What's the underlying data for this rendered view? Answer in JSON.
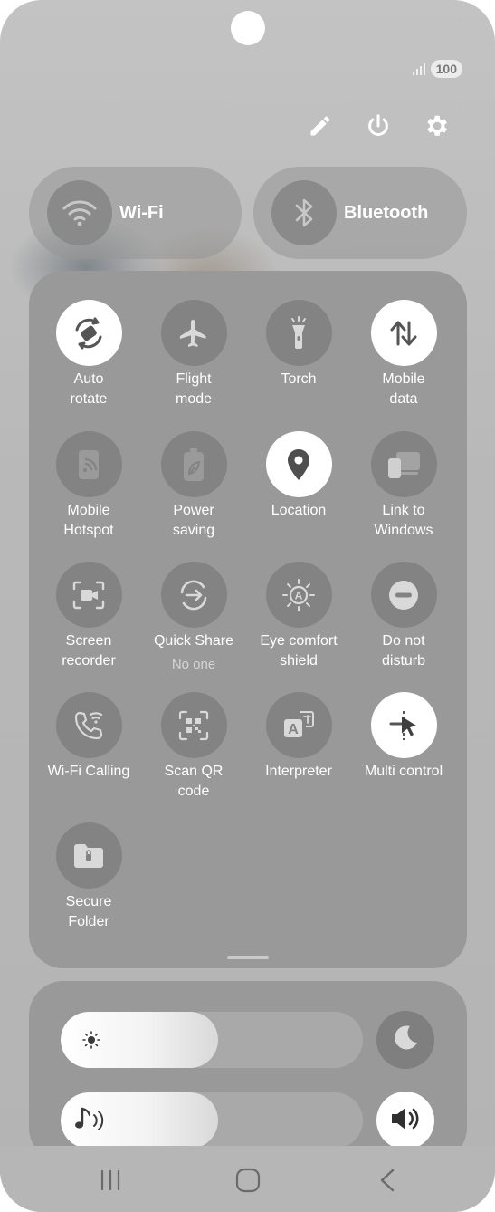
{
  "status": {
    "battery": "100"
  },
  "top_actions": [
    {
      "name": "edit",
      "icon": "pencil-icon"
    },
    {
      "name": "power",
      "icon": "power-icon"
    },
    {
      "name": "settings",
      "icon": "gear-icon"
    }
  ],
  "wifi": {
    "label": "Wi-Fi",
    "icon": "wifi-icon"
  },
  "bluetooth": {
    "label": "Bluetooth",
    "icon": "bluetooth-icon"
  },
  "tiles": [
    {
      "label": "Auto\nrotate",
      "icon": "auto-rotate-icon",
      "active": true
    },
    {
      "label": "Flight\nmode",
      "icon": "airplane-icon",
      "active": false
    },
    {
      "label": "Torch",
      "icon": "torch-icon",
      "active": false
    },
    {
      "label": "Mobile\ndata",
      "icon": "mobile-data-icon",
      "active": true
    },
    {
      "label": "Mobile\nHotspot",
      "icon": "hotspot-icon",
      "active": false
    },
    {
      "label": "Power\nsaving",
      "icon": "battery-leaf-icon",
      "active": false
    },
    {
      "label": "Location",
      "icon": "location-pin-icon",
      "active": true
    },
    {
      "label": "Link to\nWindows",
      "icon": "link-windows-icon",
      "active": false
    },
    {
      "label": "Screen\nrecorder",
      "icon": "screen-recorder-icon",
      "active": false
    },
    {
      "label": "Quick Share",
      "sub": "No one",
      "icon": "quick-share-icon",
      "active": false
    },
    {
      "label": "Eye comfort\nshield",
      "icon": "eye-comfort-icon",
      "active": false
    },
    {
      "label": "Do not\ndisturb",
      "icon": "do-not-disturb-icon",
      "active": false
    },
    {
      "label": "Wi-Fi Calling",
      "icon": "wifi-calling-icon",
      "active": false
    },
    {
      "label": "Scan QR\ncode",
      "icon": "qr-code-icon",
      "active": false
    },
    {
      "label": "Interpreter",
      "icon": "interpreter-icon",
      "active": false
    },
    {
      "label": "Multi control",
      "icon": "multi-control-icon",
      "active": true
    },
    {
      "label": "Secure\nFolder",
      "icon": "secure-folder-icon",
      "active": false
    }
  ],
  "sliders": {
    "brightness": {
      "level": 0.52,
      "icon": "sun-icon",
      "side_icon": "moon-icon"
    },
    "volume": {
      "level": 0.52,
      "icon": "music-volume-icon",
      "side_icon": "speaker-icon"
    }
  },
  "navigation": [
    "recents-icon",
    "home-icon",
    "back-icon"
  ]
}
